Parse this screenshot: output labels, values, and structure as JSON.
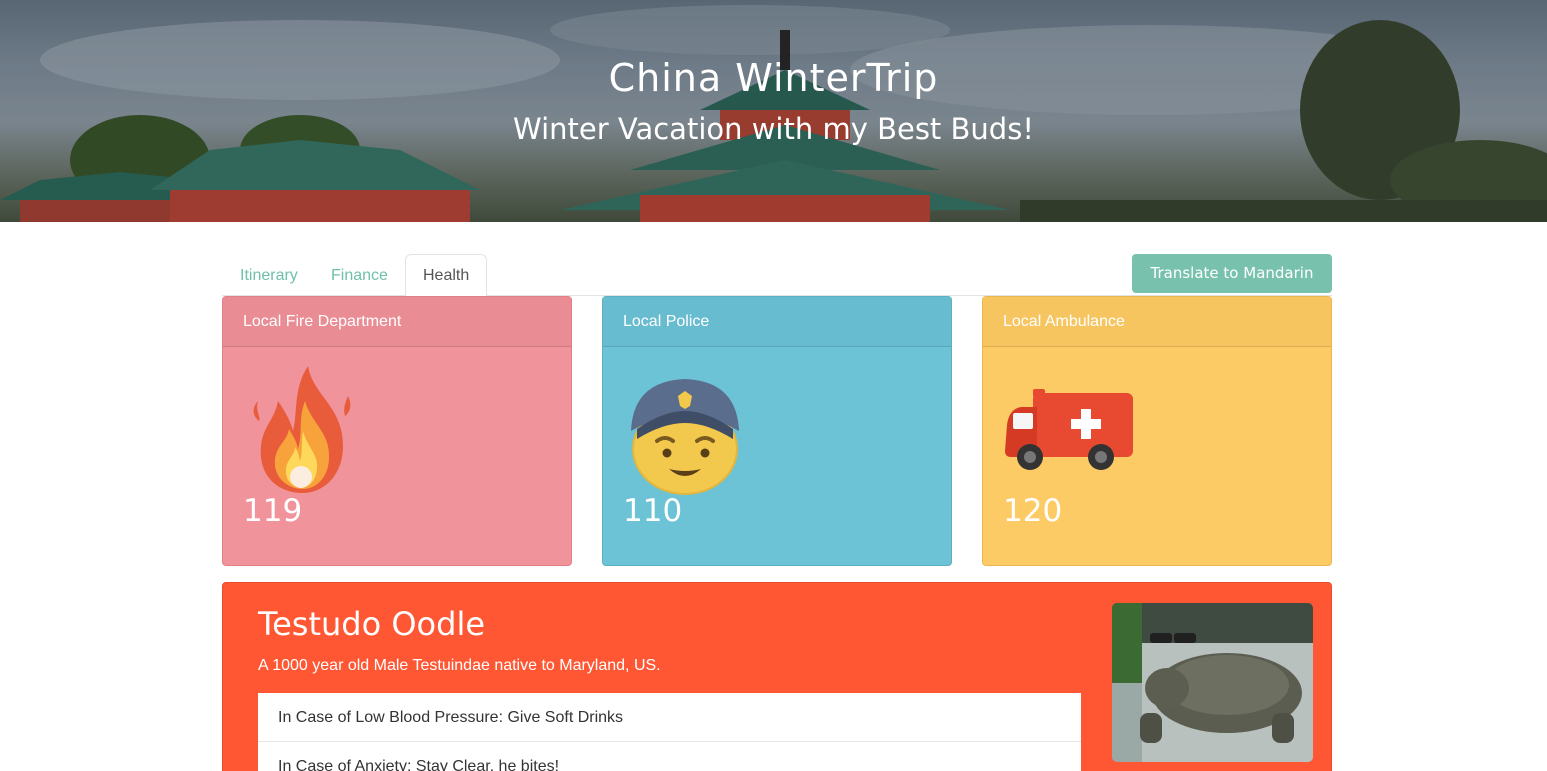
{
  "hero": {
    "title": "China WinterTrip",
    "subtitle": "Winter Vacation with my Best Buds!"
  },
  "tabs": [
    {
      "label": "Itinerary",
      "active": false
    },
    {
      "label": "Finance",
      "active": false
    },
    {
      "label": "Health",
      "active": true
    }
  ],
  "translate_button": {
    "label": "Translate to Mandarin"
  },
  "emergency": {
    "fire": {
      "title": "Local Fire Department",
      "number": "119",
      "icon": "fire-icon",
      "color": "#f1939a"
    },
    "police": {
      "title": "Local Police",
      "number": "110",
      "icon": "police-officer-icon",
      "color": "#6cc3d5"
    },
    "ambulance": {
      "title": "Local Ambulance",
      "number": "120",
      "icon": "ambulance-icon",
      "color": "#fdcb65"
    }
  },
  "pet": {
    "name": "Testudo Oodle",
    "description": "A 1000 year old Male Testuindae native to Maryland, US.",
    "care": [
      "In Case of Low Blood Pressure: Give Soft Drinks",
      "In Case of Anxiety: Stay Clear, he bites!"
    ],
    "accent_color": "#ff5733"
  }
}
